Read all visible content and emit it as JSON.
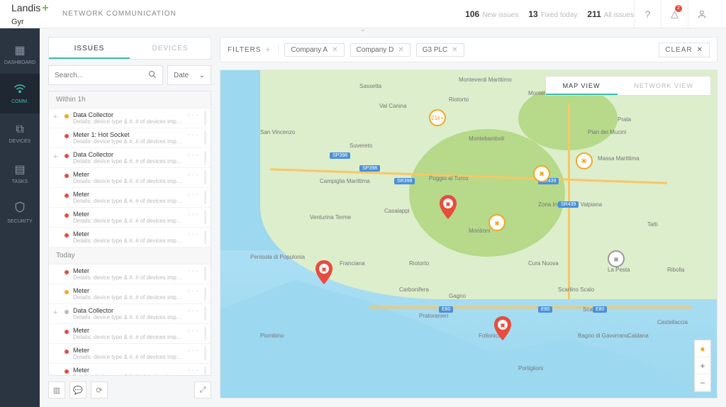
{
  "brand": {
    "line1": "Landis",
    "line2": "Gyr"
  },
  "section": "NETWORK COMMUNICATION",
  "stats": {
    "new_n": "106",
    "new_l": "New issues",
    "fixed_n": "13",
    "fixed_l": "Fixed today",
    "all_n": "211",
    "all_l": "All issues"
  },
  "alert_count": "2",
  "nav": [
    {
      "label": "DASHBOARD"
    },
    {
      "label": "COMM."
    },
    {
      "label": "DEVICES"
    },
    {
      "label": "TASKS"
    },
    {
      "label": "SECURITY"
    }
  ],
  "tabs": {
    "issues": "ISSUES",
    "devices": "DEVICES"
  },
  "search": {
    "placeholder": "Search..."
  },
  "date_label": "Date",
  "groups": [
    {
      "title": "Within 1h",
      "rows": [
        {
          "plus": true,
          "color": "orange",
          "title": "Data Collector",
          "detail": "Details: device type & #, # of devices impacted, addres..."
        },
        {
          "plus": false,
          "color": "red",
          "title": "Meter 1: Hot Socket",
          "detail": "Details: device type & #, # of devices impacted, addres..."
        },
        {
          "plus": true,
          "color": "red",
          "title": "Data Collector",
          "detail": "Details: device type & #, # of devices impacted, addres..."
        },
        {
          "plus": false,
          "color": "red",
          "title": "Meter",
          "detail": "Details: device type & #, # of devices impacted, addres..."
        },
        {
          "plus": false,
          "color": "red",
          "title": "Meter",
          "detail": "Details: device type & #, # of devices impacted, addres..."
        },
        {
          "plus": false,
          "color": "red",
          "title": "Meter",
          "detail": "Details: device type & #, # of devices impacted, addres..."
        },
        {
          "plus": false,
          "color": "red",
          "title": "Meter",
          "detail": "Details: device type & #, # of devices impacted, addres..."
        }
      ]
    },
    {
      "title": "Today",
      "rows": [
        {
          "plus": false,
          "color": "red",
          "title": "Meter",
          "detail": "Details: device type & #, # of devices impacted, addres..."
        },
        {
          "plus": false,
          "color": "orange",
          "title": "Meter",
          "detail": "Details: device type & #, # of devices impacted, addres..."
        },
        {
          "plus": true,
          "color": "grey",
          "title": "Data Collector",
          "detail": "Details: device type & #, # of devices impacted, addres..."
        },
        {
          "plus": false,
          "color": "red",
          "title": "Meter",
          "detail": "Details: device type & #, # of devices impacted, addres..."
        },
        {
          "plus": false,
          "color": "red",
          "title": "Meter",
          "detail": "Details: device type & #, # of devices impacted, addres..."
        },
        {
          "plus": false,
          "color": "red",
          "title": "Meter",
          "detail": "Details: device type & #, # of devices impacted, addres..."
        }
      ]
    }
  ],
  "filters": {
    "label": "FILTERS",
    "chips": [
      "Company A",
      "Company D",
      "G3 PLC"
    ],
    "clear": "CLEAR"
  },
  "views": {
    "map": "MAP VIEW",
    "network": "NETWORK VIEW"
  },
  "cluster_label": "21k+",
  "map_places": [
    "Sassetta",
    "Val Canina",
    "Riotorto",
    "San Vincenzo",
    "Suvereto",
    "Montebamboli",
    "Campiglia Marittima",
    "Venturina Terme",
    "Poggio al Turco",
    "Casalappi",
    "Montioni",
    "Zona Industriale Valpiana",
    "Penisola di Populonia",
    "Franciana",
    "Riotorto",
    "Cura Nuova",
    "Carbonifera",
    "Gagno",
    "Pratoranieri",
    "Piombino",
    "Follonica",
    "Scarlino",
    "Scarlino Scalo",
    "Caldana",
    "Tatti",
    "Monteverdi Marittimo",
    "Monterotondo Marittimo",
    "Pian dei Mucini",
    "Massa Marittima",
    "Prata",
    "Ribolla",
    "Castellaccia",
    "La Pesta",
    "Portiglioni",
    "Bagno di Gavorrano"
  ],
  "roads": [
    "SP398",
    "SP398",
    "SR398",
    "SR439",
    "SR439",
    "E80",
    "E80",
    "E80"
  ]
}
